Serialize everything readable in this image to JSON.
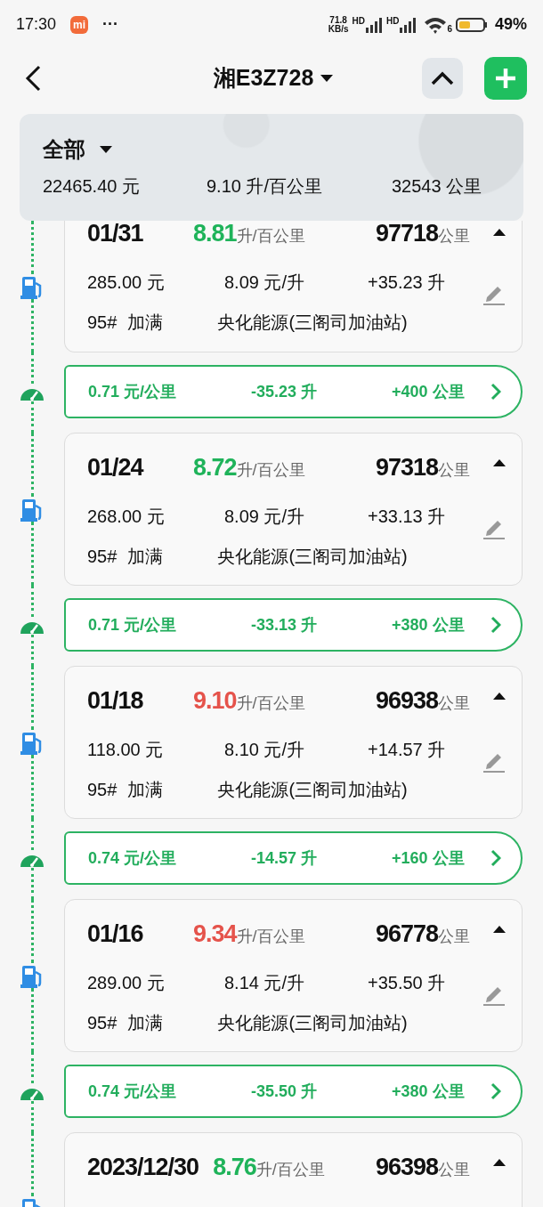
{
  "status_bar": {
    "time": "17:30",
    "app_badge": "mi",
    "more": "···",
    "net_speed": "71.8",
    "net_unit": "KB/s",
    "signals": [
      {
        "label": "HD"
      },
      {
        "label": "HD"
      }
    ],
    "wifi_label": "6",
    "battery": "49%"
  },
  "header": {
    "title": "湘E3Z728"
  },
  "summary": {
    "filter": "全部",
    "total_cost": "22465.40 元",
    "avg_consumption": "9.10 升/百公里",
    "total_distance": "32543 公里"
  },
  "entries": [
    {
      "kind": "refuel",
      "date": "01/31",
      "consumption": "8.81",
      "consumption_unit": "升/百公里",
      "color": "#1fb35a",
      "odometer": "97718",
      "odometer_unit": "公里",
      "amount": "285.00 元",
      "price": "8.09 元/升",
      "volume": "+35.23 升",
      "fuel": "95#",
      "fill": "加满",
      "station": "央化能源(三阁司加油站)"
    },
    {
      "kind": "segment",
      "cost_per_km": "0.71 元/公里",
      "fuel_used": "-35.23 升",
      "distance": "+400 公里"
    },
    {
      "kind": "refuel",
      "date": "01/24",
      "consumption": "8.72",
      "consumption_unit": "升/百公里",
      "color": "#1fb35a",
      "odometer": "97318",
      "odometer_unit": "公里",
      "amount": "268.00 元",
      "price": "8.09 元/升",
      "volume": "+33.13 升",
      "fuel": "95#",
      "fill": "加满",
      "station": "央化能源(三阁司加油站)"
    },
    {
      "kind": "segment",
      "cost_per_km": "0.71 元/公里",
      "fuel_used": "-33.13 升",
      "distance": "+380 公里"
    },
    {
      "kind": "refuel",
      "date": "01/18",
      "consumption": "9.10",
      "consumption_unit": "升/百公里",
      "color": "#e5534b",
      "odometer": "96938",
      "odometer_unit": "公里",
      "amount": "118.00 元",
      "price": "8.10 元/升",
      "volume": "+14.57 升",
      "fuel": "95#",
      "fill": "加满",
      "station": "央化能源(三阁司加油站)"
    },
    {
      "kind": "segment",
      "cost_per_km": "0.74 元/公里",
      "fuel_used": "-14.57 升",
      "distance": "+160 公里"
    },
    {
      "kind": "refuel",
      "date": "01/16",
      "consumption": "9.34",
      "consumption_unit": "升/百公里",
      "color": "#e5534b",
      "odometer": "96778",
      "odometer_unit": "公里",
      "amount": "289.00 元",
      "price": "8.14 元/升",
      "volume": "+35.50 升",
      "fuel": "95#",
      "fill": "加满",
      "station": "央化能源(三阁司加油站)"
    },
    {
      "kind": "segment",
      "cost_per_km": "0.74 元/公里",
      "fuel_used": "-35.50 升",
      "distance": "+380 公里"
    },
    {
      "kind": "refuel",
      "date": "2023/12/30",
      "consumption": "8.76",
      "consumption_unit": "升/百公里",
      "color": "#1fb35a",
      "odometer": "96398",
      "odometer_unit": "公里"
    }
  ]
}
